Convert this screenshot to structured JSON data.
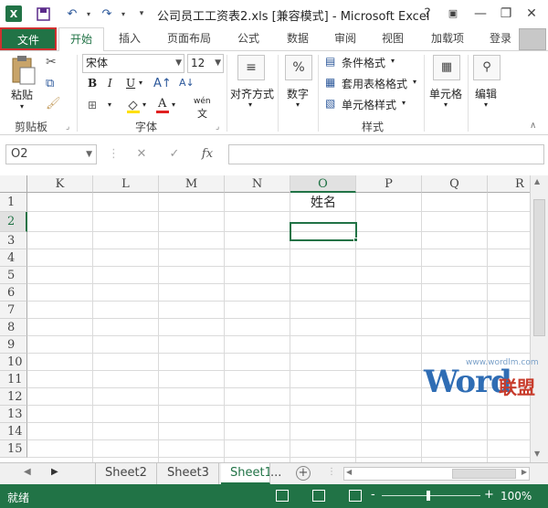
{
  "title_bar": {
    "title": "公司员工工资表2.xls  [兼容模式] - Microsoft Excel",
    "help": "?",
    "app_icon": "X",
    "icons": [
      "excel-logo-icon",
      "save-icon",
      "undo-icon",
      "redo-icon",
      "customize-icon"
    ]
  },
  "ribbon_tabs": [
    {
      "label": "文件"
    },
    {
      "label": "开始"
    },
    {
      "label": "插入"
    },
    {
      "label": "页面布局"
    },
    {
      "label": "公式"
    },
    {
      "label": "数据"
    },
    {
      "label": "审阅"
    },
    {
      "label": "视图"
    },
    {
      "label": "加载项"
    },
    {
      "label": "登录"
    }
  ],
  "ribbon": {
    "clipboard": {
      "paste": "粘贴",
      "label": "剪贴板"
    },
    "font": {
      "name": "宋体",
      "size": "12",
      "bold": "B",
      "italic": "I",
      "underline": "U",
      "color_a": "A",
      "wen": "wén",
      "label": "字体"
    },
    "alignment": {
      "label": "对齐方式"
    },
    "number": {
      "label": "数字",
      "symbol": "%"
    },
    "styles": {
      "cond": "条件格式",
      "table": "套用表格格式",
      "cell": "单元格样式",
      "label": "样式"
    },
    "cells": {
      "label": "单元格"
    },
    "editing": {
      "label": "编辑"
    }
  },
  "formula_bar": {
    "name_box": "O2",
    "cancel": "✕",
    "enter": "✓",
    "fx": "fx",
    "value": ""
  },
  "grid": {
    "columns": [
      "K",
      "L",
      "M",
      "N",
      "O",
      "P",
      "Q",
      "R"
    ],
    "rows": [
      "1",
      "2",
      "3",
      "4",
      "5",
      "6",
      "7",
      "8",
      "9",
      "10",
      "11",
      "12",
      "13",
      "14",
      "15"
    ],
    "selected_column": "O",
    "selected_row": "2",
    "cell_o1": "姓名"
  },
  "sheets": {
    "tabs": [
      "Sheet2",
      "Sheet3",
      "Sheet1"
    ],
    "active": "Sheet1",
    "more": "...",
    "add": "+"
  },
  "status": {
    "ready": "就绪",
    "zoom": "100%",
    "minus": "-",
    "plus": "+"
  },
  "watermark": {
    "url": "www.wordlm.com",
    "big": "Word",
    "cn": "联盟"
  },
  "colors": {
    "accent": "#217346",
    "file_border": "#d03030"
  }
}
